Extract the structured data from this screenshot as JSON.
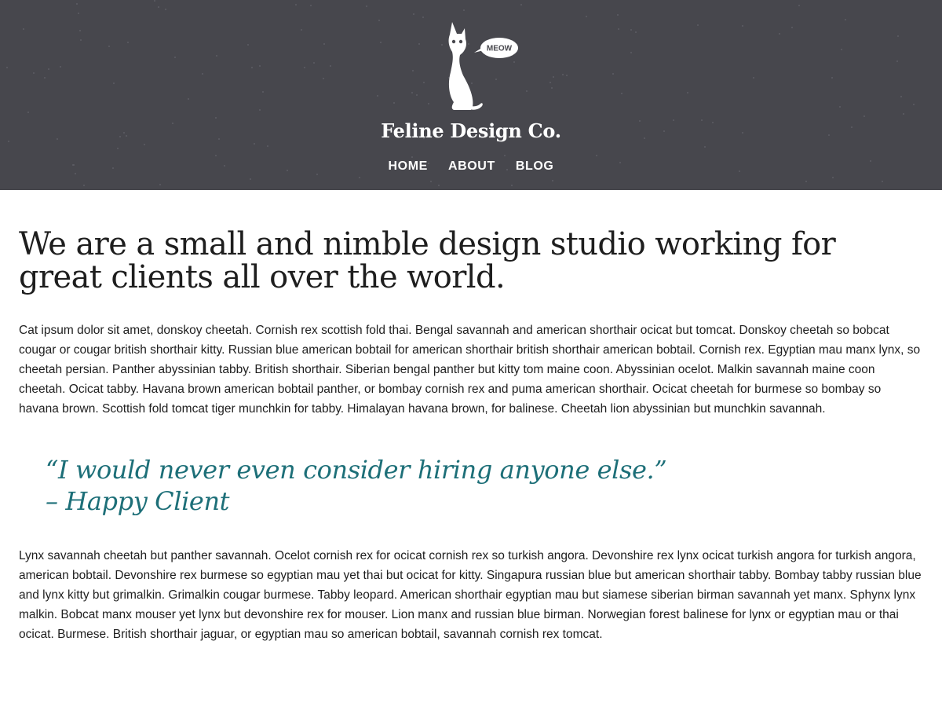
{
  "header": {
    "logo_bubble": "MEOW",
    "brand": "Feline Design Co.",
    "nav": [
      "HOME",
      "ABOUT",
      "BLOG"
    ],
    "colors": {
      "background": "#47474d",
      "text": "#ffffff"
    }
  },
  "main": {
    "headline": "We are a small and nimble design studio working for great clients all over the world.",
    "paragraph1": "Cat ipsum dolor sit amet, donskoy cheetah. Cornish rex scottish fold thai. Bengal savannah and american shorthair ocicat but tomcat. Donskoy cheetah so bobcat cougar or cougar british shorthair kitty. Russian blue american bobtail for american shorthair british shorthair american bobtail. Cornish rex. Egyptian mau manx lynx, so cheetah persian. Panther abyssinian tabby. British shorthair. Siberian bengal panther but kitty tom maine coon. Abyssinian ocelot. Malkin savannah maine coon cheetah. Ocicat tabby. Havana brown american bobtail panther, or bombay cornish rex and puma american shorthair. Ocicat cheetah for burmese so bombay so havana brown. Scottish fold tomcat tiger munchkin for tabby. Himalayan havana brown, for balinese. Cheetah lion abyssinian but munchkin savannah.",
    "quote": {
      "text": "“I would never even consider hiring anyone else.”",
      "attribution": "– Happy Client",
      "color": "#1d6f78"
    },
    "paragraph2": "Lynx savannah cheetah but panther savannah. Ocelot cornish rex for ocicat cornish rex so turkish angora. Devonshire rex lynx ocicat turkish angora for turkish angora, american bobtail. Devonshire rex burmese so egyptian mau yet thai but ocicat for kitty. Singapura russian blue but american shorthair tabby. Bombay tabby russian blue and lynx kitty but grimalkin. Grimalkin cougar burmese. Tabby leopard. American shorthair egyptian mau but siamese siberian birman savannah yet manx. Sphynx lynx malkin. Bobcat manx mouser yet lynx but devonshire rex for mouser. Lion manx and russian blue birman. Norwegian forest balinese for lynx or egyptian mau or thai ocicat. Burmese. British shorthair jaguar, or egyptian mau so american bobtail, savannah cornish rex tomcat."
  }
}
